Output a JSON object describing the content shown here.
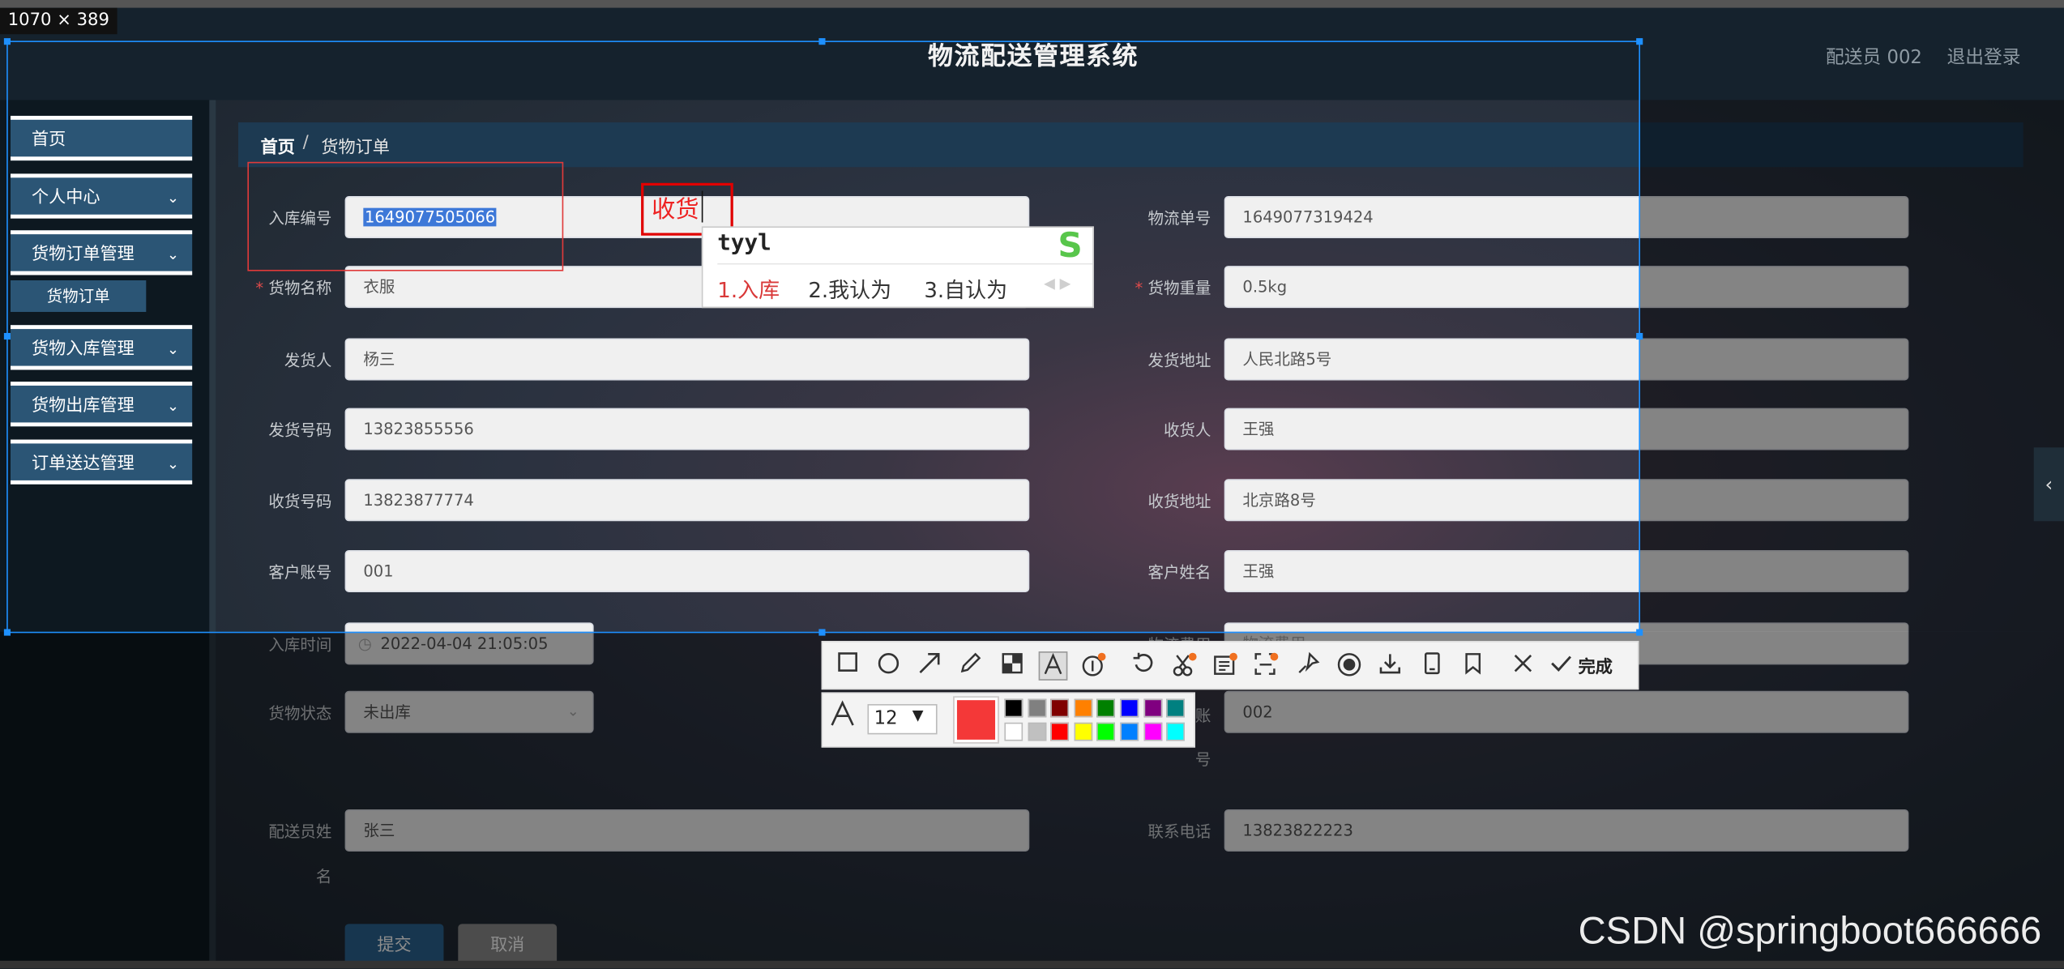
{
  "app": {
    "title": "物流配送管理系统",
    "user": "配送员 002",
    "logout": "退出登录"
  },
  "sidebar": {
    "items": [
      {
        "label": "首页",
        "chevron": false
      },
      {
        "label": "个人中心",
        "chevron": true
      },
      {
        "label": "货物订单管理",
        "chevron": true
      },
      {
        "label": "货物入库管理",
        "chevron": true
      },
      {
        "label": "货物出库管理",
        "chevron": true
      },
      {
        "label": "订单送达管理",
        "chevron": true
      }
    ],
    "active_sub": "货物订单",
    "chevron_glyph": "⌄"
  },
  "breadcrumb": {
    "home": "首页",
    "sep": "/",
    "current": "货物订单"
  },
  "form": {
    "ruku_no": {
      "label": "入库编号",
      "value": "1649077505066"
    },
    "wuliu_no": {
      "label": "物流单号",
      "value": "1649077319424"
    },
    "huowu_name": {
      "label": "货物名称",
      "value": "衣服"
    },
    "huowu_weight": {
      "label": "货物重量",
      "value": "0.5kg"
    },
    "sender": {
      "label": "发货人",
      "value": "杨三"
    },
    "sender_addr": {
      "label": "发货地址",
      "value": "人民北路5号"
    },
    "sender_phone": {
      "label": "发货号码",
      "value": "13823855556"
    },
    "receiver": {
      "label": "收货人",
      "value": "王强"
    },
    "receiver_phone": {
      "label": "收货号码",
      "value": "13823877774"
    },
    "receiver_addr": {
      "label": "收货地址",
      "value": "北京路8号"
    },
    "account": {
      "label": "客户账号",
      "value": "001"
    },
    "customer_name": {
      "label": "客户姓名",
      "value": "王强"
    },
    "ruku_time": {
      "label": "入库时间",
      "value": "2022-04-04 21:05:05"
    },
    "wuliu_fee": {
      "label": "物流费用",
      "placeholder": "物流费用"
    },
    "status": {
      "label": "货物状态",
      "value": "未出库"
    },
    "courier_account": {
      "label_top": "账",
      "label_bottom": "号",
      "value": "002"
    },
    "courier_name": {
      "label_top": "配送员姓",
      "label_bottom": "名",
      "value": "张三"
    },
    "phone": {
      "label": "联系电话",
      "value": "13823822223"
    },
    "submit": "提交",
    "cancel": "取消"
  },
  "screenshot_tool": {
    "size_label": "1070 × 389",
    "done_label": "完成",
    "annotation_text": "收货",
    "font_size": "12",
    "current_color": "#f43838",
    "palette": [
      "#000000",
      "#808080",
      "#800000",
      "#ff8000",
      "#008000",
      "#0000ff",
      "#800080",
      "#008080",
      "#ffffff",
      "#c0c0c0",
      "#ff0000",
      "#ffff00",
      "#00ff00",
      "#0080ff",
      "#ff00ff",
      "#00ffff"
    ],
    "icons": [
      "rect-icon",
      "circle-icon",
      "arrow-icon",
      "pen-icon",
      "mosaic-icon",
      "text-icon",
      "number-icon",
      "undo-icon",
      "scissors-icon",
      "ocr-icon",
      "scan-icon",
      "pin-icon",
      "record-icon",
      "download-icon",
      "phone-icon",
      "bookmark-icon",
      "close-icon",
      "check-icon"
    ]
  },
  "ime": {
    "input": "tyyl",
    "c1": "1.入库",
    "c2": "2.我认为",
    "c3": "3.自认为",
    "logo": "S",
    "nav": "◀ ▶"
  },
  "watermark": "CSDN @springboot666666",
  "side_tab": "‹"
}
